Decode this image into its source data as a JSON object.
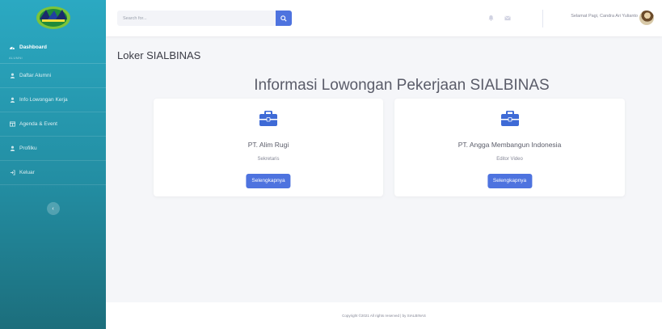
{
  "sidebar": {
    "items": [
      {
        "label": "Dashboard",
        "icon": "tachometer-icon"
      },
      {
        "label": "Daftar Alumni",
        "icon": "user-icon"
      },
      {
        "label": "Info Lowongan Kerja",
        "icon": "user-icon"
      },
      {
        "label": "Agenda & Event",
        "icon": "table-icon"
      },
      {
        "label": "Profilku",
        "icon": "user-icon"
      },
      {
        "label": "Keluar",
        "icon": "sign-out-icon"
      }
    ],
    "heading": "ALUMNI"
  },
  "topbar": {
    "search_placeholder": "Search for...",
    "greeting": "Selamat Pagi, Candra Ari Yulianto"
  },
  "main": {
    "page_title": "Loker SIALBINAS",
    "section_title": "Informasi Lowongan Pekerjaan SIALBINAS",
    "jobs": [
      {
        "company": "PT. Alim Rugi",
        "position": "Sekretaris",
        "button": "Selengkapnya"
      },
      {
        "company": "PT. Angga Membangun Indonesia",
        "position": "Editor Video",
        "button": "Selengkapnya"
      }
    ]
  },
  "footer": {
    "copyright": "Copyright ©2021 All rights reserved | by SIALBINAS"
  },
  "colors": {
    "sidebar_top": "#2ba9c2",
    "sidebar_bottom": "#1c6e7c",
    "primary": "#4e73df",
    "icon_color": "#3e6ad6"
  }
}
